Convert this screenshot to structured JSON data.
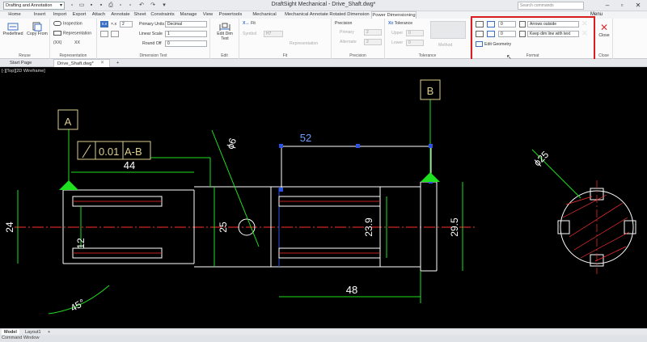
{
  "window": {
    "title": "DraftSight Mechanical - Drive_Shaft.dwg*",
    "workspace": "Drafting and Annotation",
    "search_placeholder": "Search commands"
  },
  "ribbon_tabs": [
    "Home",
    "Insert",
    "Import",
    "Export",
    "Attach",
    "Annotate",
    "Sheet",
    "Constraints",
    "Manage",
    "View",
    "Powertools",
    "Mechanical Content",
    "Mechanical Annotate",
    "Rotated Dimension",
    "Power Dimensioning"
  ],
  "active_tab": "Power Dimensioning",
  "menu_label": "Menu",
  "ribbon": {
    "reuse": {
      "label": "Reuse",
      "predefined": "Predefined",
      "copy_from": "Copy From"
    },
    "representation": {
      "label": "Representation",
      "inspection": "Inspection",
      "representation": "Representation",
      "xxx": "(XX)",
      "xx_small": "XX"
    },
    "dimension_text": {
      "label": "Dimension Text",
      "xx_label": "×.x",
      "xx_value": "2",
      "primary_units_label": "Primary Units",
      "primary_units_value": "Decimal",
      "linear_scale_label": "Linear Scale",
      "linear_scale_value": "1",
      "round_off_label": "Round Off",
      "round_off_value": "0"
    },
    "edit": {
      "label": "Edit",
      "edit_dim_text": "Edit Dim Text"
    },
    "fit": {
      "label": "Fit",
      "fit": "Fit",
      "symbol": "Symbol",
      "symbol_value": "H7",
      "representation": "Representation"
    },
    "precision": {
      "label": "Precision",
      "precision_title": "Precision",
      "primary": "Primary",
      "primary_value": "2",
      "alternate": "Alternate",
      "alternate_value": "2"
    },
    "tolerance": {
      "label": "Tolerance",
      "tolerance_title": "Tolerance",
      "upper": "Upper",
      "upper_value": "0",
      "lower": "Lower",
      "lower_value": "0",
      "method": "Method"
    },
    "format": {
      "label": "Format",
      "value1": "0",
      "value2": "0",
      "arrows": "Arrows outside",
      "dim_line": "Keep dim line with text",
      "edit_geometry": "Edit Geometry"
    },
    "close": {
      "label": "Close",
      "close": "Close"
    }
  },
  "doc_tabs": [
    "Start Page",
    "Drive_Shaft.dwg*"
  ],
  "view_label": "[-][Top][2D Wireframe]",
  "layout_tabs": [
    "Model",
    "Layout1"
  ],
  "command_label": "Command Window",
  "drawing": {
    "datum_a": "A",
    "datum_b": "B",
    "fcf_value": "0.01",
    "fcf_datum": "A-B",
    "dim_44": "44",
    "dim_52": "52",
    "dim_24": "24",
    "dim_12": "12",
    "dim_25": "25",
    "dim_23_9": "23.9",
    "dim_29_5": "29.5",
    "dim_48": "48",
    "dim_45": "45°",
    "dim_phi6": "ϕ6",
    "dim_phi25": "ϕ25"
  },
  "colors": {
    "highlight": "#d81e1e",
    "green": "#1fe01f",
    "geometry": "#ffffff",
    "centerline": "#ff3030",
    "selection": "#2b52e0"
  }
}
